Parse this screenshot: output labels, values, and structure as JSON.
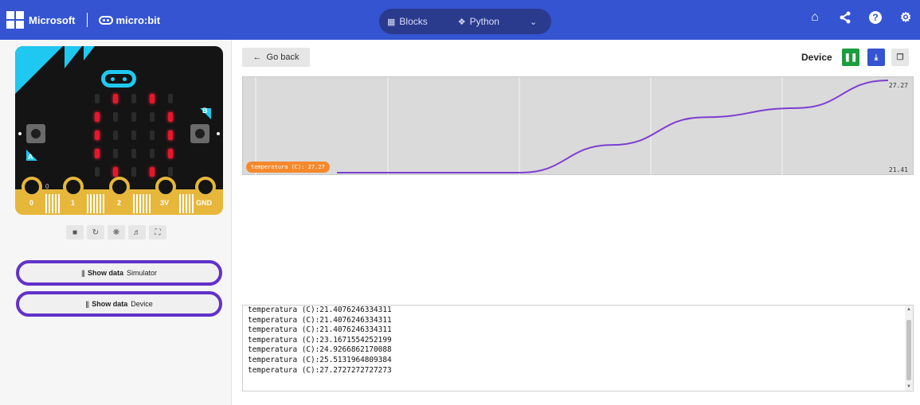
{
  "header": {
    "brand_microsoft": "Microsoft",
    "brand_product": "micro:bit",
    "tabs": [
      {
        "label": "Blocks",
        "icon": "blocks-icon"
      },
      {
        "label": "Python",
        "icon": "python-icon"
      }
    ],
    "right_icons": [
      "home-icon",
      "share-icon",
      "help-icon",
      "settings-icon"
    ],
    "color": "#3454d1"
  },
  "simulator": {
    "pin_labels": [
      "0",
      "1",
      "2",
      "3V",
      "GND"
    ],
    "pin_zero_value": "0",
    "button_a": "A",
    "button_b": "B",
    "led_matrix": [
      [
        0,
        1,
        0,
        1,
        0
      ],
      [
        1,
        0,
        0,
        0,
        1
      ],
      [
        1,
        0,
        0,
        0,
        1
      ],
      [
        1,
        0,
        0,
        0,
        1
      ],
      [
        0,
        1,
        0,
        1,
        0
      ]
    ],
    "tools": [
      "stop-icon",
      "restart-icon",
      "debug-icon",
      "sound-icon",
      "fullscreen-icon"
    ],
    "show_data_buttons": [
      {
        "label": "Show data",
        "target": "Simulator"
      },
      {
        "label": "Show data",
        "target": "Device"
      }
    ]
  },
  "toolbar": {
    "go_back": "Go back",
    "device_label": "Device"
  },
  "chart_data": {
    "type": "line",
    "series": [
      {
        "name": "temperatura (C)",
        "values": [
          21.41,
          21.41,
          21.41,
          23.17,
          24.93,
          25.51,
          27.27
        ]
      }
    ],
    "ylim": [
      21.41,
      27.27
    ],
    "y_max_label": "27.27",
    "y_min_label": "21.41",
    "tag": "temperatura (C): 27.27",
    "line_color": "#7b3fd1",
    "grid": true
  },
  "console": {
    "lines": [
      "temperatura (C):21.4076246334311",
      "temperatura (C):21.4076246334311",
      "temperatura (C):21.4076246334311",
      "temperatura (C):23.1671554252199",
      "temperatura (C):24.9266862170088",
      "temperatura (C):25.5131964809384",
      "temperatura (C):27.2727272727273"
    ]
  }
}
